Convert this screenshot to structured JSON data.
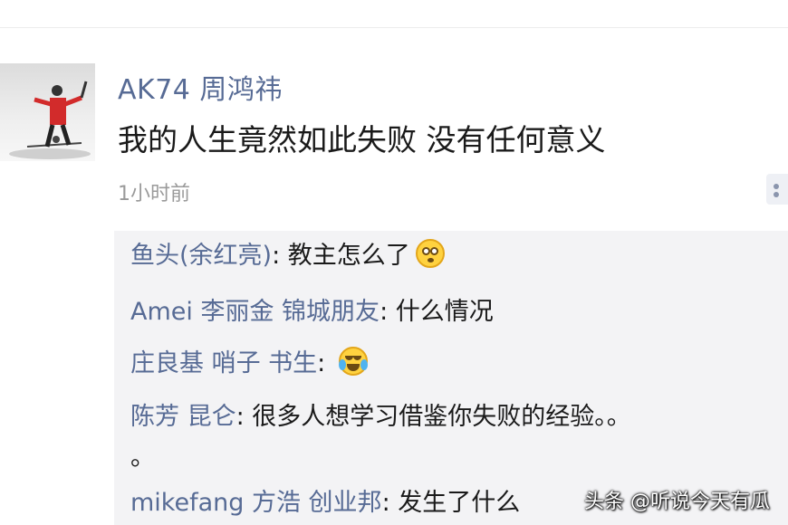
{
  "post": {
    "username": "AK74 周鸿祎",
    "text": "我的人生竟然如此失败 没有任何意义",
    "timestamp": "1小时前"
  },
  "comments": [
    {
      "name": "鱼头(余红亮)",
      "sep": ": ",
      "text": "教主怎么了",
      "emoji": "flushed-emoji-icon"
    },
    {
      "name": "Amei 李丽金 锦城朋友",
      "sep": ": ",
      "text": "什么情况",
      "emoji": ""
    },
    {
      "name": "庄良基 哨子 书生",
      "sep": ": ",
      "text": "",
      "emoji": "crying-emoji-icon"
    },
    {
      "name": "陈芳 昆仑",
      "sep": ": ",
      "text": "很多人想学习借鉴你失败的经验。。",
      "text_cont": "。",
      "emoji": ""
    },
    {
      "name": "mikefang 方浩 创业邦",
      "sep": ": ",
      "text": "发生了什么",
      "emoji": ""
    }
  ],
  "watermark": "头条 @听说今天有瓜",
  "colors": {
    "link": "#576b95",
    "text": "#1a1a1a",
    "muted": "#9a9a9a",
    "comment_bg": "#f3f3f5"
  }
}
